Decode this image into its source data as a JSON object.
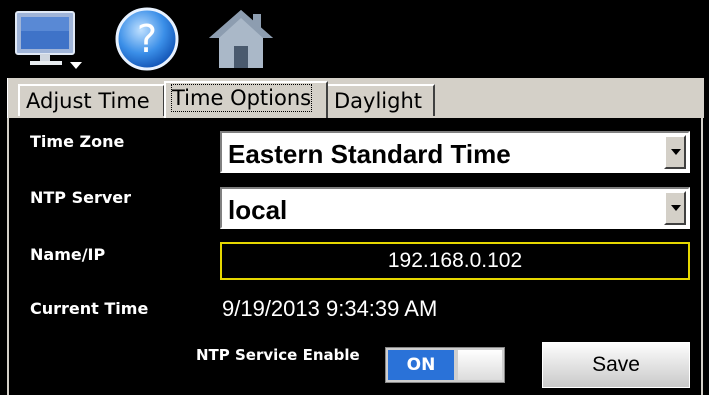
{
  "toolbar": {
    "icons": [
      "monitor-icon",
      "help-icon",
      "home-icon"
    ]
  },
  "tabs": [
    {
      "label": "Adjust Time",
      "active": false
    },
    {
      "label": "Time Options",
      "active": true
    },
    {
      "label": "Daylight",
      "active": false
    }
  ],
  "form": {
    "time_zone": {
      "label": "Time Zone",
      "value": "Eastern Standard Time"
    },
    "ntp_server": {
      "label": "NTP Server",
      "value": "local"
    },
    "name_ip": {
      "label": "Name/IP",
      "value": "192.168.0.102"
    },
    "current_time": {
      "label": "Current Time",
      "value": "9/19/2013 9:34:39 AM"
    },
    "ntp_enable": {
      "label": "NTP Service Enable",
      "state": "ON"
    },
    "save_label": "Save"
  },
  "colors": {
    "accent_blue": "#2a72d8",
    "field_border": "#e6d700",
    "tab_bg": "#d4d0c8"
  }
}
